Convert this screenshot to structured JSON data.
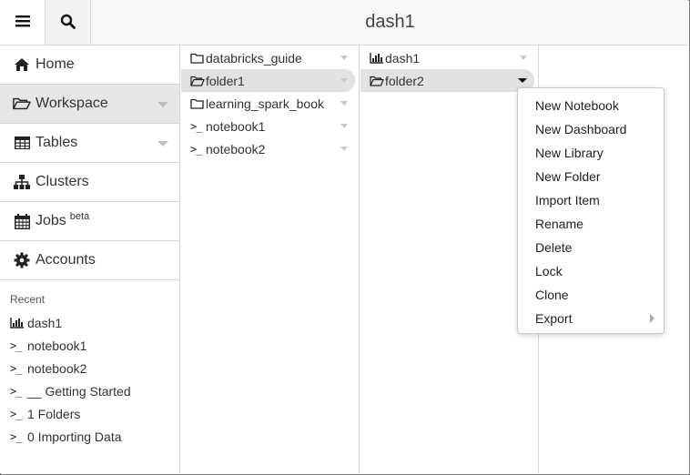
{
  "topbar": {
    "title": "dash1",
    "menu_icon": "hamburger-icon",
    "search_icon": "search-icon"
  },
  "sidebar": {
    "items": [
      {
        "label": "Home",
        "icon": "home-icon"
      },
      {
        "label": "Workspace",
        "icon": "folder-open-icon"
      },
      {
        "label": "Tables",
        "icon": "table-icon"
      },
      {
        "label": "Clusters",
        "icon": "sitemap-icon"
      },
      {
        "label": "Jobs",
        "badge": "beta",
        "icon": "calendar-icon"
      },
      {
        "label": "Accounts",
        "icon": "gear-icon"
      }
    ],
    "recent_title": "Recent",
    "recent": [
      {
        "label": "dash1",
        "icon": "dashboard-icon"
      },
      {
        "label": "notebook1",
        "icon": "terminal-icon"
      },
      {
        "label": "notebook2",
        "icon": "terminal-icon"
      },
      {
        "label": "__ Getting Started",
        "icon": "terminal-icon"
      },
      {
        "label": "1 Folders",
        "icon": "terminal-icon"
      },
      {
        "label": "0 Importing Data",
        "icon": "terminal-icon"
      }
    ]
  },
  "column1": {
    "items": [
      {
        "label": "databricks_guide",
        "icon": "folder-icon"
      },
      {
        "label": "folder1",
        "icon": "folder-open-icon"
      },
      {
        "label": "learning_spark_book",
        "icon": "folder-icon"
      },
      {
        "label": "notebook1",
        "icon": "terminal-icon"
      },
      {
        "label": "notebook2",
        "icon": "terminal-icon"
      }
    ]
  },
  "column2": {
    "items": [
      {
        "label": "dash1",
        "icon": "dashboard-icon"
      },
      {
        "label": "folder2",
        "icon": "folder-open-icon"
      }
    ]
  },
  "context_menu": {
    "items": [
      {
        "label": "New Notebook"
      },
      {
        "label": "New Dashboard"
      },
      {
        "label": "New Library"
      },
      {
        "label": "New Folder"
      },
      {
        "label": "Import Item"
      },
      {
        "label": "Rename"
      },
      {
        "label": "Delete"
      },
      {
        "label": "Lock"
      },
      {
        "label": "Clone"
      },
      {
        "label": "Export",
        "submenu": true
      }
    ]
  },
  "colors": {
    "selected_bg": "#e2e2e2",
    "active_nav_bg": "#e6e6e6",
    "border": "#d6d6d6"
  }
}
